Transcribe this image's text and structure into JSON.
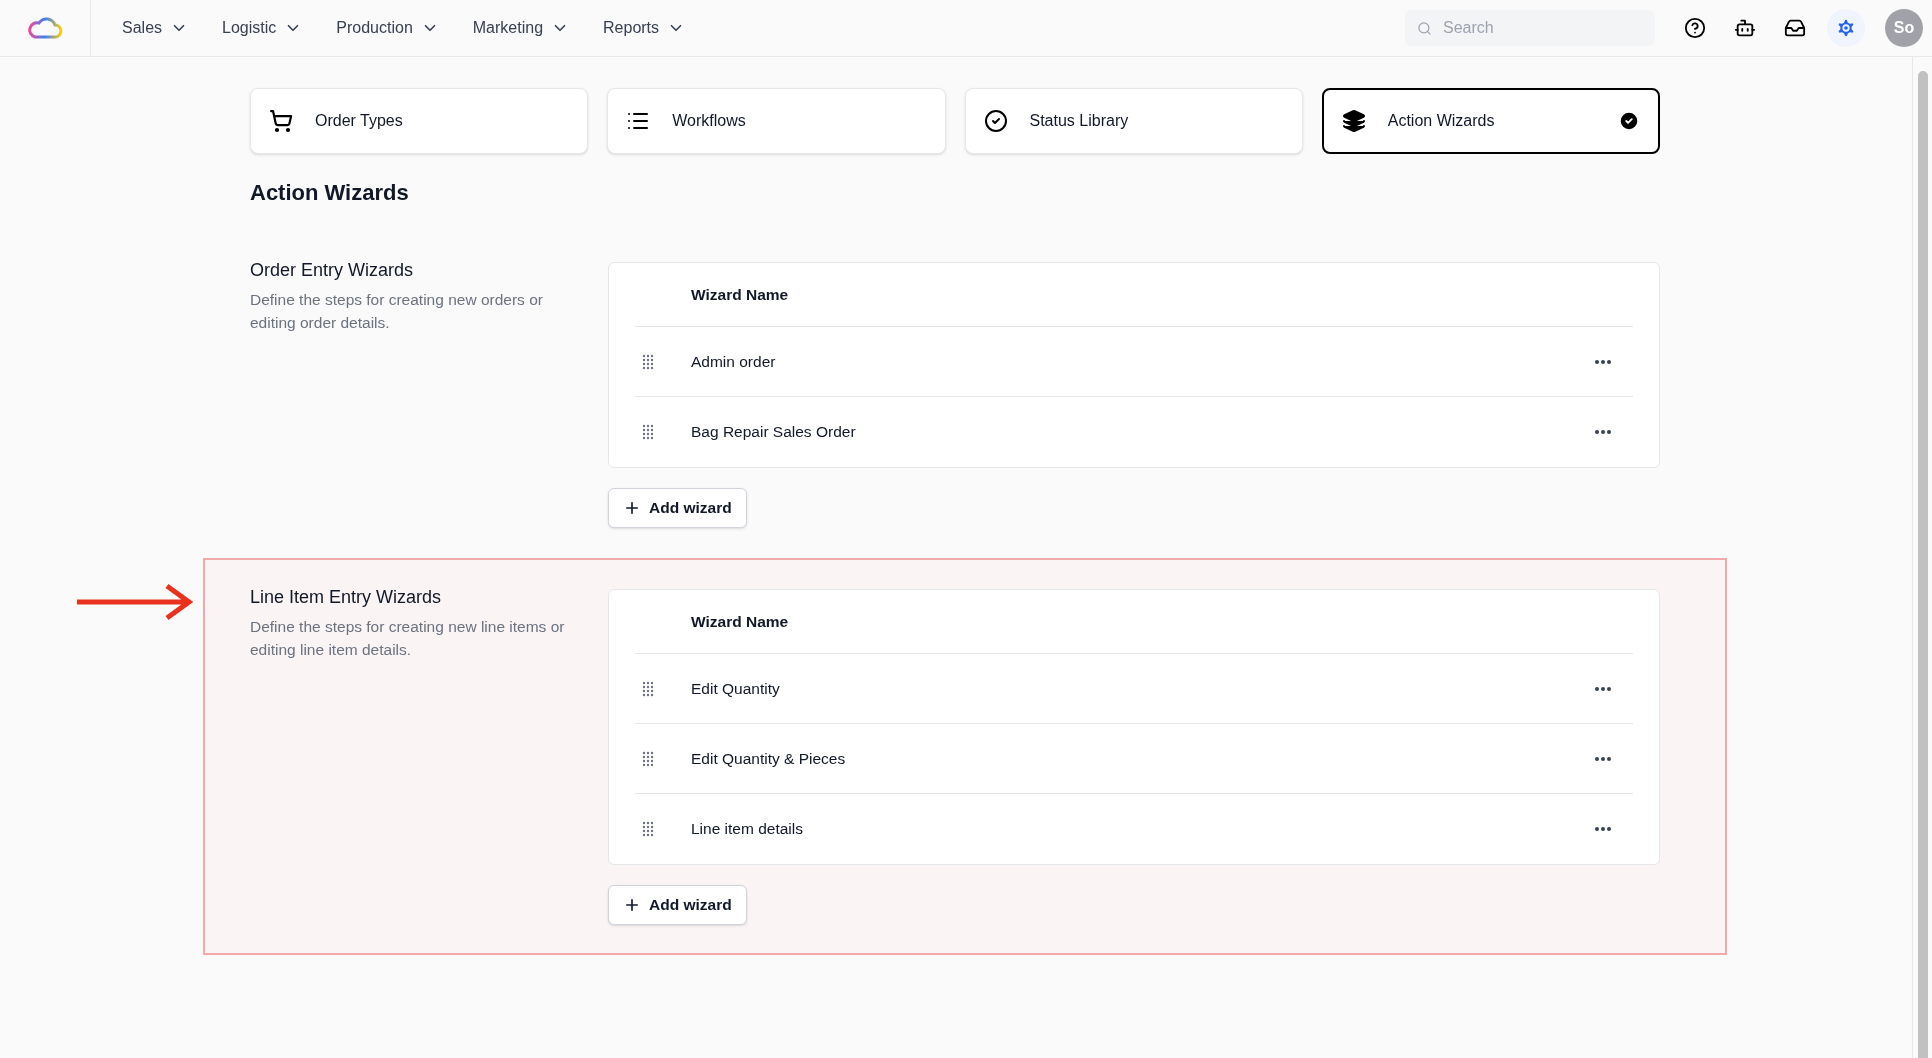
{
  "nav": {
    "menus": [
      {
        "label": "Sales"
      },
      {
        "label": "Logistic"
      },
      {
        "label": "Production"
      },
      {
        "label": "Marketing"
      },
      {
        "label": "Reports"
      }
    ],
    "search": {
      "placeholder": "Search"
    },
    "avatar": "So"
  },
  "tabs": [
    {
      "label": "Order Types",
      "kind": "cart",
      "selected": false
    },
    {
      "label": "Workflows",
      "kind": "list",
      "selected": false
    },
    {
      "label": "Status Library",
      "kind": "status",
      "selected": false
    },
    {
      "label": "Action Wizards",
      "kind": "layers",
      "selected": true
    }
  ],
  "page_title": "Action Wizards",
  "sections": [
    {
      "title": "Order Entry Wizards",
      "description": "Define the steps for creating new orders or editing order details.",
      "highlighted": false,
      "column": "Wizard Name",
      "rows": [
        "Admin order",
        "Bag Repair Sales Order"
      ],
      "add_button": "Add wizard"
    },
    {
      "title": "Line Item Entry Wizards",
      "description": "Define the steps for creating new line items or editing line item details.",
      "highlighted": true,
      "column": "Wizard Name",
      "rows": [
        "Edit Quantity",
        "Edit Quantity & Pieces",
        "Line item details"
      ],
      "add_button": "Add wizard"
    }
  ]
}
